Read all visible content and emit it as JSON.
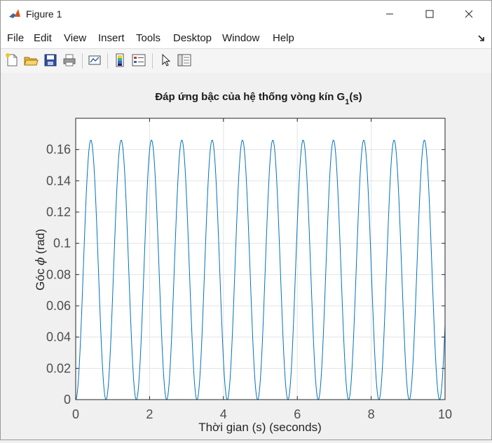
{
  "window": {
    "title": "Figure 1",
    "minimize_label": "—",
    "maximize_label": "☐",
    "close_label": "✕"
  },
  "menu": {
    "items": [
      {
        "label": "File"
      },
      {
        "label": "Edit"
      },
      {
        "label": "View"
      },
      {
        "label": "Insert"
      },
      {
        "label": "Tools"
      },
      {
        "label": "Desktop"
      },
      {
        "label": "Window"
      },
      {
        "label": "Help"
      }
    ]
  },
  "toolbar": {
    "icons": [
      "new-figure-icon",
      "open-file-icon",
      "save-icon",
      "print-icon",
      "link-plot-icon",
      "insert-colorbar-icon",
      "insert-legend-icon",
      "edit-plot-icon",
      "property-inspector-icon"
    ]
  },
  "chart_data": {
    "type": "line",
    "title_main": "Đáp ứng bậc của hệ thống vòng kín G",
    "title_sub": "1",
    "title_tail": "(s)",
    "xlabel": "Thời gian (s) (seconds)",
    "ylabel_prefix": "Góc ",
    "ylabel_symbol": "ϕ",
    "ylabel_suffix": " (rad)",
    "xlim": [
      0,
      10
    ],
    "ylim": [
      0,
      0.18
    ],
    "xticks": [
      0,
      2,
      4,
      6,
      8,
      10
    ],
    "yticks": [
      0,
      0.02,
      0.04,
      0.06,
      0.08,
      0.1,
      0.12,
      0.14,
      0.16
    ],
    "xtick_labels": [
      "0",
      "2",
      "4",
      "6",
      "8",
      "10"
    ],
    "ytick_labels": [
      "0",
      "0.02",
      "0.04",
      "0.06",
      "0.08",
      "0.1",
      "0.12",
      "0.14",
      "0.16"
    ],
    "grid": true,
    "series": [
      {
        "color": "#0072bd",
        "model": "0.083*(1-cos(2*pi*t/0.821))",
        "amplitude": 0.083,
        "period": 0.821
      }
    ]
  }
}
